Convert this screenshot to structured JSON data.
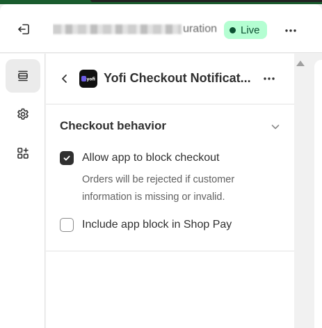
{
  "header": {
    "title_suffix": "uration",
    "status_badge": "Live",
    "icons": {
      "exit": "exit-icon",
      "more": "more-horizontal-icon"
    }
  },
  "rail": {
    "items": [
      {
        "name": "sections",
        "icon": "sections-icon",
        "active": true
      },
      {
        "name": "settings",
        "icon": "gear-icon",
        "active": false
      },
      {
        "name": "apps",
        "icon": "apps-add-icon",
        "active": false
      }
    ]
  },
  "panel": {
    "app_title": "Yofi Checkout Notificat...",
    "app_logo_text": "yofi",
    "section": {
      "title": "Checkout behavior",
      "options": [
        {
          "label": "Allow app to block checkout",
          "checked": true,
          "help": "Orders will be rejected if customer information is missing or invalid."
        },
        {
          "label": "Include app block in Shop Pay",
          "checked": false
        }
      ]
    }
  },
  "colors": {
    "live_badge_bg": "#b4fed2",
    "live_badge_text": "#0c5132",
    "checkbox_checked": "#303030",
    "top_strip": "#1a5c2e"
  }
}
